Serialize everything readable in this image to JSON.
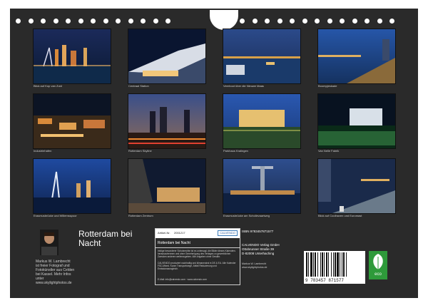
{
  "calendar": {
    "title": "Rotterdam bei Nacht",
    "author_name": "Markus W. Lambrecht",
    "author_bio": "ist freier Fotograf und Fotokünstler aus Celden bei Kassel. Mehr Infos unter",
    "author_url": "www.skylightphotos.de"
  },
  "photos": [
    {
      "caption": "Blick auf Kop van Zuid"
    },
    {
      "caption": "Centraal Station"
    },
    {
      "caption": "Veerboot über die Nieuwe Maas"
    },
    {
      "caption": "Boompjeskade"
    },
    {
      "caption": "Industriehafen"
    },
    {
      "caption": "Rotterdam Skyline"
    },
    {
      "caption": "Parkhaus Kralingen"
    },
    {
      "caption": "Van Nelle Fabrik"
    },
    {
      "caption": "Erasmusbrücke und Willemsspoor"
    },
    {
      "caption": "Rotterdam Zentrum"
    },
    {
      "caption": "Erasmusbrücke am Schollevaartweg"
    },
    {
      "caption": "Blick auf Coolhaven und Euromast"
    }
  ],
  "info": {
    "article_label": "Artikel-Nr.",
    "article_no": "2001217",
    "brand": "CALVENDO",
    "product_title": "Rotterdam bei Nacht",
    "legal_1": "Infolge besonderer Schutzrechte ist es untersagt, die Bilder dieses Kalenders herauszutrennen und ohne Genehmigung des Verlages zu gewerblichen Zwecken anderen weiterzugeben. Alle Angaben ohne Gewähr.",
    "legal_2": "CALVENDO produziert nachhaltig und klimaneutral in DE & EU. Alle Kalender FSC-Mixed. Kurze Transportwege, Abfall Reduzierung und Emissionsausgleich.",
    "email": "E-Mail: info@calvendo.com · www.calvendo.com",
    "isbn": "ISBN 9783457871577",
    "publisher_1": "CALVENDO Verlag GmbH",
    "publisher_2": "Ottobrunner Straße 39",
    "publisher_3": "D-82008 Unterhaching",
    "copyright": "Markus W. Lambrecht",
    "copyright_url": "www.skylightphotos.de",
    "barcode_digits": "9 783457 871577",
    "eco_label": "eco"
  }
}
